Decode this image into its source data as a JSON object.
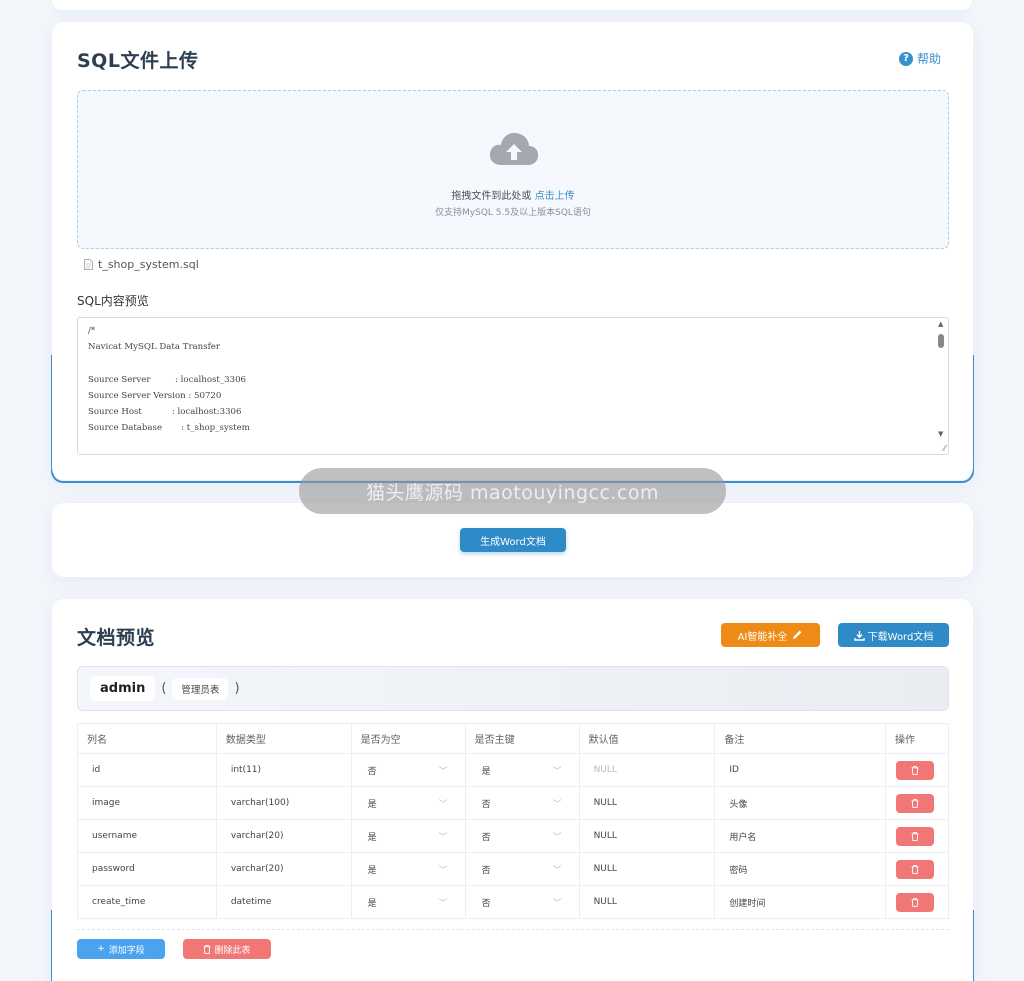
{
  "upload": {
    "title": "SQL文件上传",
    "help_label": "帮助",
    "drop_text": "拖拽文件到此处或 ",
    "drop_link": "点击上传",
    "drop_hint": "仅支持MySQL 5.5及以上版本SQL语句",
    "file_name": "t_shop_system.sql",
    "preview_label": "SQL内容预览",
    "sql_lines": [
      "/*",
      "Navicat MySQL Data Transfer",
      "",
      "Source Server         : localhost_3306",
      "Source Server Version : 50720",
      "Source Host           : localhost:3306",
      "Source Database       : t_shop_system"
    ]
  },
  "generate": {
    "button_label": "生成Word文档"
  },
  "watermark": "猫头鹰源码 maotouyingcc.com",
  "preview": {
    "title": "文档预览",
    "ai_button_label": "AI智能补全",
    "download_button_label": "下载Word文档",
    "table_name": "admin",
    "paren_open": "(",
    "paren_close": ")",
    "table_comment": "管理员表",
    "columns": [
      "列名",
      "数据类型",
      "是否为空",
      "是否主键",
      "默认值",
      "备注",
      "操作"
    ],
    "rows": [
      {
        "name": "id",
        "type": "int(11)",
        "nullable": "否",
        "primary": "是",
        "default": "NULL",
        "comment": "ID"
      },
      {
        "name": "image",
        "type": "varchar(100)",
        "nullable": "是",
        "primary": "否",
        "default": "NULL",
        "comment": "头像"
      },
      {
        "name": "username",
        "type": "varchar(20)",
        "nullable": "是",
        "primary": "否",
        "default": "NULL",
        "comment": "用户名"
      },
      {
        "name": "password",
        "type": "varchar(20)",
        "nullable": "是",
        "primary": "否",
        "default": "NULL",
        "comment": "密码"
      },
      {
        "name": "create_time",
        "type": "datetime",
        "nullable": "是",
        "primary": "否",
        "default": "NULL",
        "comment": "创建时间"
      }
    ],
    "add_field_label": "添加字段",
    "delete_table_label": "删除此表"
  },
  "colors": {
    "primary": "#2f8bc8",
    "accent_orange": "#ee8b17",
    "danger": "#f17676",
    "light_blue": "#4aa3ef"
  }
}
